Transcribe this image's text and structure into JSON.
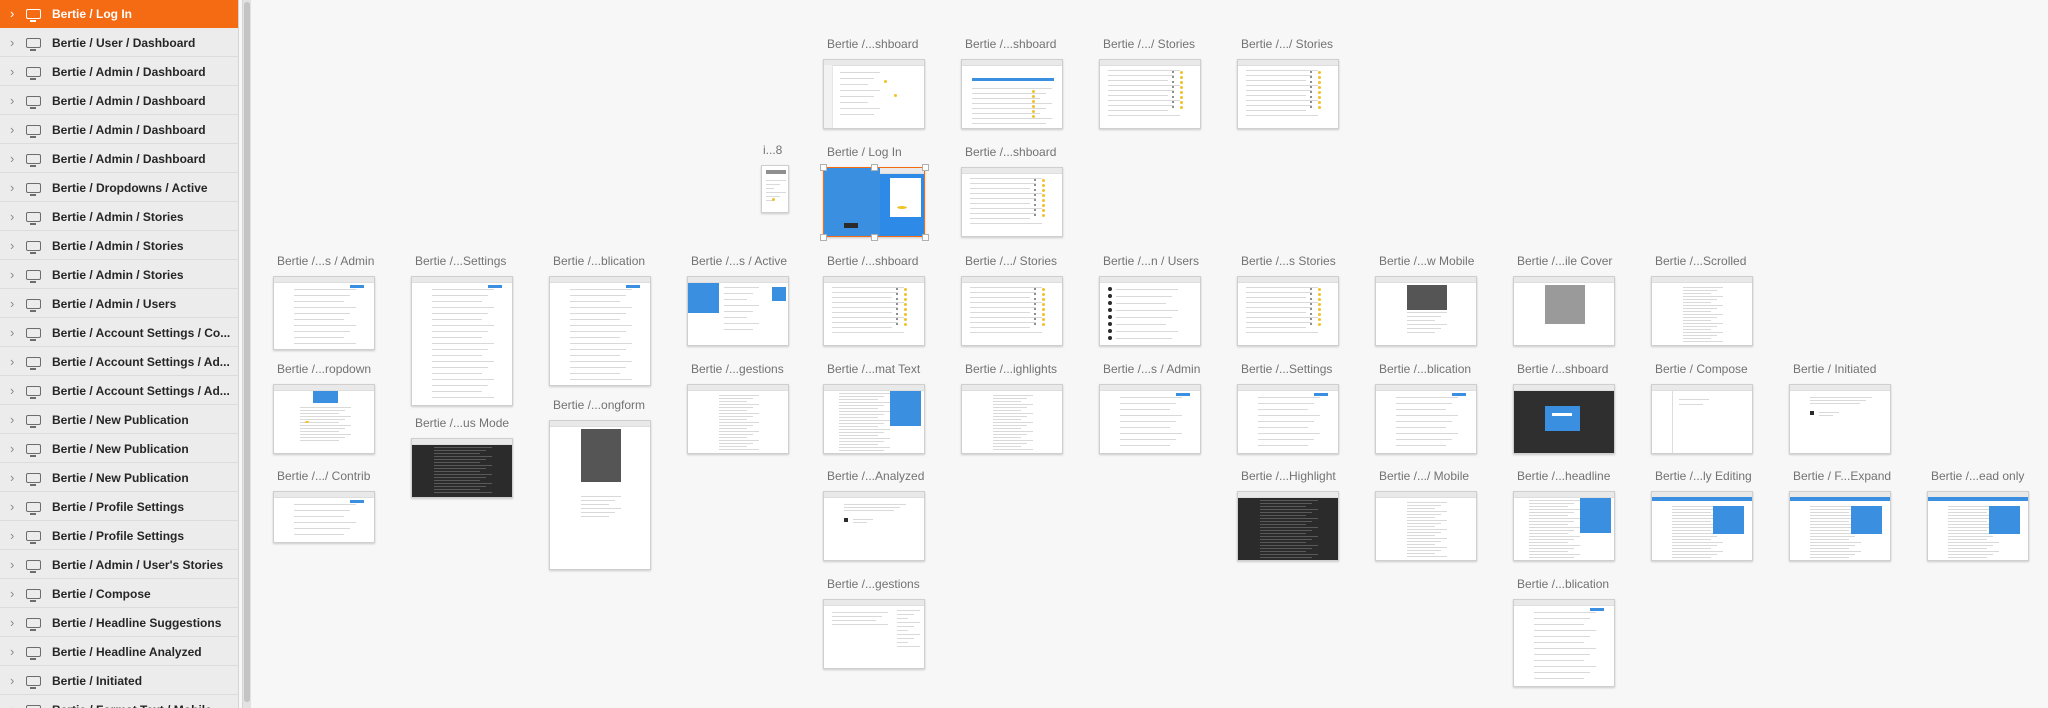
{
  "sidebar": {
    "items": [
      {
        "label": "Bertie / Log In",
        "active": true
      },
      {
        "label": "Bertie / User / Dashboard"
      },
      {
        "label": "Bertie / Admin / Dashboard"
      },
      {
        "label": "Bertie / Admin / Dashboard"
      },
      {
        "label": "Bertie / Admin / Dashboard"
      },
      {
        "label": "Bertie / Admin / Dashboard"
      },
      {
        "label": "Bertie / Dropdowns / Active"
      },
      {
        "label": "Bertie / Admin / Stories"
      },
      {
        "label": "Bertie / Admin / Stories"
      },
      {
        "label": "Bertie / Admin / Stories"
      },
      {
        "label": "Bertie / Admin / Users"
      },
      {
        "label": "Bertie / Account Settings / Co..."
      },
      {
        "label": "Bertie / Account Settings / Ad..."
      },
      {
        "label": "Bertie / Account Settings / Ad..."
      },
      {
        "label": "Bertie / New Publication"
      },
      {
        "label": "Bertie / New Publication"
      },
      {
        "label": "Bertie / New Publication"
      },
      {
        "label": "Bertie / Profile Settings"
      },
      {
        "label": "Bertie / Profile Settings"
      },
      {
        "label": "Bertie / Admin / User's Stories"
      },
      {
        "label": "Bertie / Compose"
      },
      {
        "label": "Bertie / Headline Suggestions"
      },
      {
        "label": "Bertie / Headline Analyzed"
      },
      {
        "label": "Bertie / Initiated"
      },
      {
        "label": "Bertie / Format Text / Mobile"
      }
    ]
  },
  "canvas": {
    "artboards": [
      {
        "title": "Bertie /...shboard",
        "kind": "dash"
      },
      {
        "title": "Bertie /...shboard",
        "kind": "chart"
      },
      {
        "title": "Bertie /.../ Stories",
        "kind": "list"
      },
      {
        "title": "Bertie /.../ Stories",
        "kind": "list"
      },
      {
        "title": "i...8",
        "kind": "mobile"
      },
      {
        "title": "Bertie / Log In",
        "kind": "login",
        "selected": true
      },
      {
        "title": "Bertie /...shboard",
        "kind": "list"
      },
      {
        "title": "Bertie /...s / Admin",
        "kind": "form"
      },
      {
        "title": "Bertie /...Settings",
        "kind": "form"
      },
      {
        "title": "Bertie /...blication",
        "kind": "form"
      },
      {
        "title": "Bertie /...s / Active",
        "kind": "active"
      },
      {
        "title": "Bertie /...shboard",
        "kind": "list"
      },
      {
        "title": "Bertie /.../ Stories",
        "kind": "list"
      },
      {
        "title": "Bertie /...n / Users",
        "kind": "users"
      },
      {
        "title": "Bertie /...s Stories",
        "kind": "list"
      },
      {
        "title": "Bertie /...w Mobile",
        "kind": "mobileimg"
      },
      {
        "title": "Bertie /...ile Cover",
        "kind": "cover"
      },
      {
        "title": "Bertie /...Scrolled",
        "kind": "text"
      },
      {
        "title": "Bertie /...s / Admin",
        "kind": "form"
      },
      {
        "title": "Bertie /...Settings",
        "kind": "form"
      },
      {
        "title": "Bertie /...blication",
        "kind": "form"
      },
      {
        "title": "Bertie /...shboard",
        "kind": "darkmodal"
      },
      {
        "title": "Bertie / Compose",
        "kind": "blank"
      },
      {
        "title": "Bertie / Initiated",
        "kind": "article"
      },
      {
        "title": "Bertie /...ropdown",
        "kind": "dropdown"
      },
      {
        "title": "Bertie /...us Mode",
        "kind": "dark"
      },
      {
        "title": "Bertie /...ongform",
        "kind": "mobileimg"
      },
      {
        "title": "Bertie /...gestions",
        "kind": "text"
      },
      {
        "title": "Bertie /...mat Text",
        "kind": "format"
      },
      {
        "title": "Bertie /...ighlights",
        "kind": "text"
      },
      {
        "title": "Bertie /.../ Contrib",
        "kind": "form"
      },
      {
        "title": "Bertie /...Analyzed",
        "kind": "article"
      },
      {
        "title": "Bertie /...Highlight",
        "kind": "dark"
      },
      {
        "title": "Bertie /.../ Mobile",
        "kind": "text"
      },
      {
        "title": "Bertie /...headline",
        "kind": "format"
      },
      {
        "title": "Bertie /...ly Editing",
        "kind": "editing"
      },
      {
        "title": "Bertie / F...Expand",
        "kind": "editing"
      },
      {
        "title": "Bertie /...ead only",
        "kind": "editing"
      },
      {
        "title": "Bertie /...gestions",
        "kind": "suggest"
      },
      {
        "title": "Bertie /...blication",
        "kind": "form"
      }
    ]
  }
}
